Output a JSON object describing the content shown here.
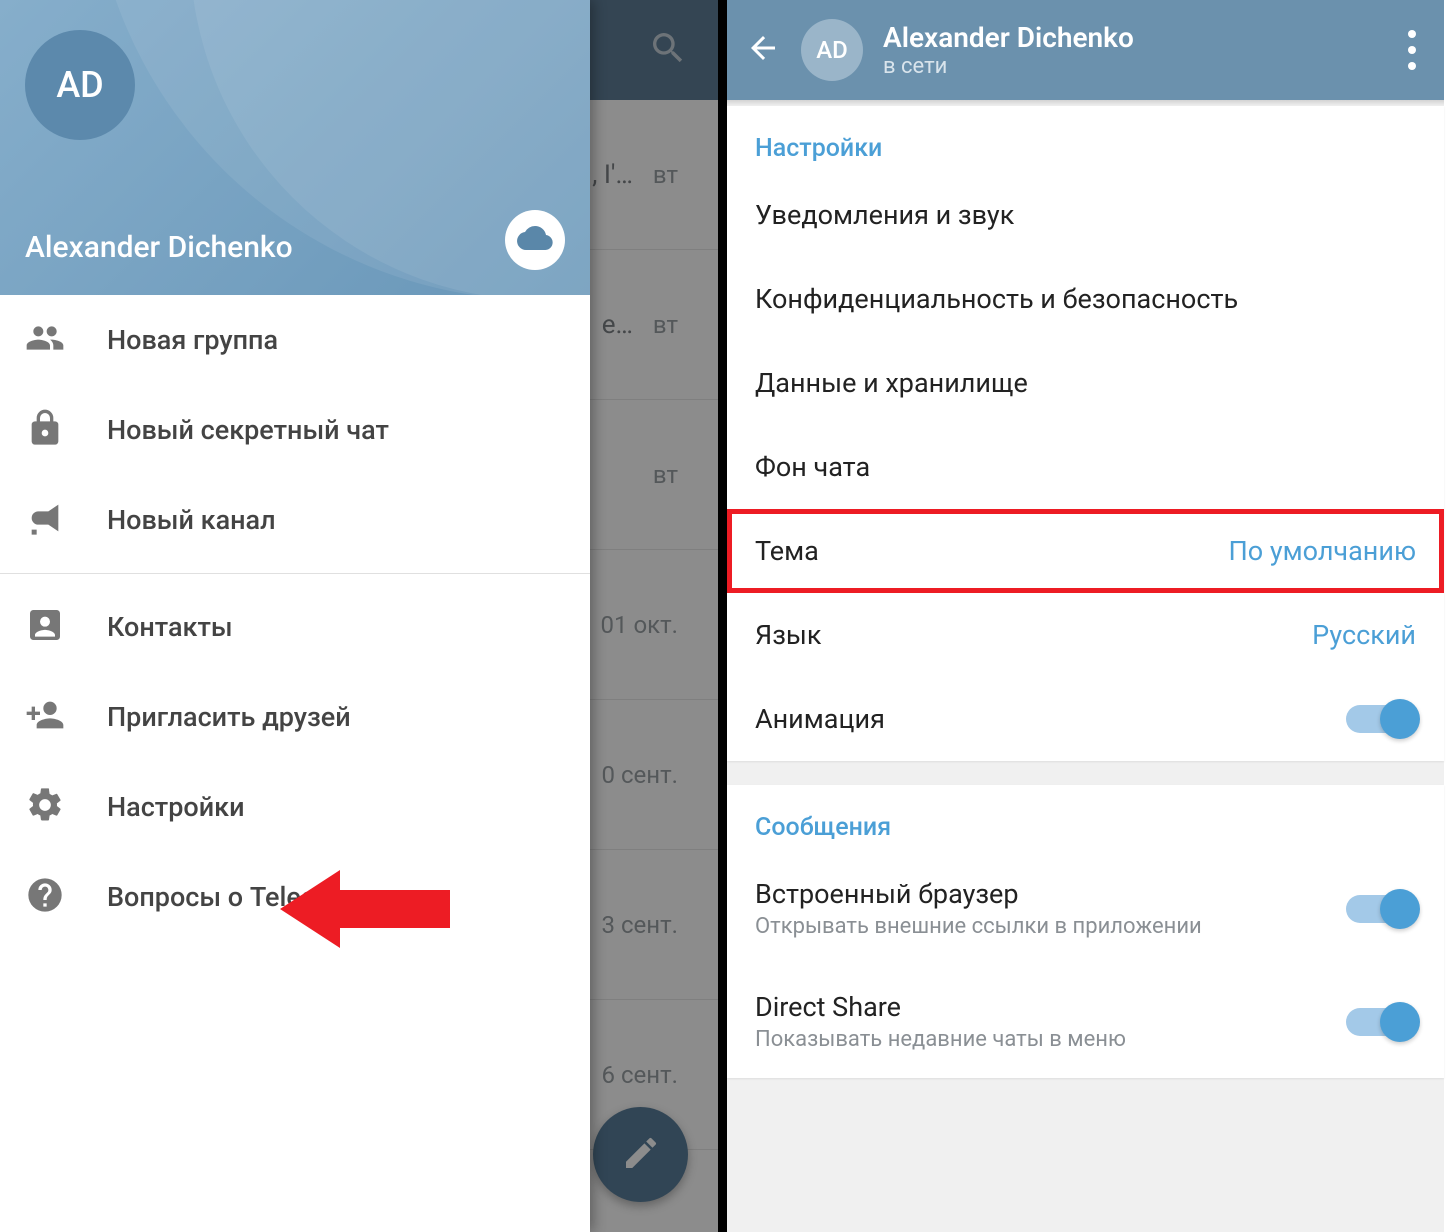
{
  "left": {
    "avatar_initials": "AD",
    "username": "Alexander Dichenko",
    "menu": [
      {
        "icon": "group-icon",
        "label": "Новая группа"
      },
      {
        "icon": "lock-icon",
        "label": "Новый секретный чат"
      },
      {
        "icon": "megaphone-icon",
        "label": "Новый канал"
      },
      {
        "icon": "contacts-icon",
        "label": "Контакты"
      },
      {
        "icon": "invite-icon",
        "label": "Пригласить друзей"
      },
      {
        "icon": "gear-icon",
        "label": "Настройки"
      },
      {
        "icon": "help-icon",
        "label": "Вопросы о Telegram"
      }
    ],
    "chat_rows": [
      {
        "preview": ", I'…",
        "date": "вт"
      },
      {
        "preview": "е…",
        "date": "вт"
      },
      {
        "preview": "",
        "date": "вт"
      },
      {
        "preview": "",
        "date": "01 окт."
      },
      {
        "preview": "",
        "date": "0 сент."
      },
      {
        "preview": "",
        "date": "3 сент."
      },
      {
        "preview": "",
        "date": "6 сент."
      }
    ]
  },
  "right": {
    "avatar_initials": "AD",
    "name": "Alexander Dichenko",
    "status": "в сети",
    "section1_title": "Настройки",
    "rows1": {
      "notifications": "Уведомления и звук",
      "privacy": "Конфиденциальность и безопасность",
      "data": "Данные и хранилище",
      "background": "Фон чата",
      "theme_label": "Тема",
      "theme_value": "По умолчанию",
      "language_label": "Язык",
      "language_value": "Русский",
      "animation": "Анимация"
    },
    "section2_title": "Сообщения",
    "rows2": {
      "browser_label": "Встроенный браузер",
      "browser_sub": "Открывать внешние ссылки в приложении",
      "directshare_label": "Direct Share",
      "directshare_sub": "Показывать недавние чаты в меню"
    }
  }
}
